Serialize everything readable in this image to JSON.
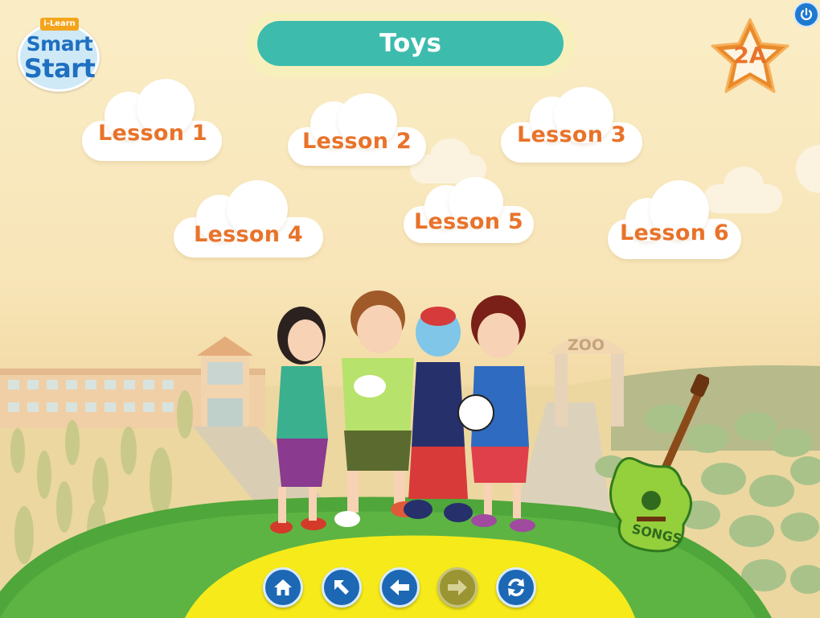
{
  "app": {
    "logo_top": "i-Learn",
    "logo_line1": "Smart",
    "logo_line2": "Start",
    "badge": "2A"
  },
  "header": {
    "title": "Toys"
  },
  "lessons": [
    {
      "label": "Lesson 1"
    },
    {
      "label": "Lesson 2"
    },
    {
      "label": "Lesson 3"
    },
    {
      "label": "Lesson 4"
    },
    {
      "label": "Lesson 5"
    },
    {
      "label": "Lesson 6"
    }
  ],
  "scene": {
    "zoo_sign": "ZOO",
    "songs_label": "SONGS"
  },
  "nav": {
    "buttons": [
      {
        "icon": "home-icon",
        "enabled": true
      },
      {
        "icon": "arrow-up-left-icon",
        "enabled": true
      },
      {
        "icon": "arrow-left-icon",
        "enabled": true
      },
      {
        "icon": "arrow-right-icon",
        "enabled": false
      },
      {
        "icon": "refresh-icon",
        "enabled": true
      }
    ]
  },
  "colors": {
    "title_pill": "#3dbcad",
    "lesson_text": "#e8732a",
    "nav_button": "#1d68b4",
    "nav_disabled": "#9a9432",
    "hill": "#4fa63a",
    "path": "#f6ea1b"
  }
}
